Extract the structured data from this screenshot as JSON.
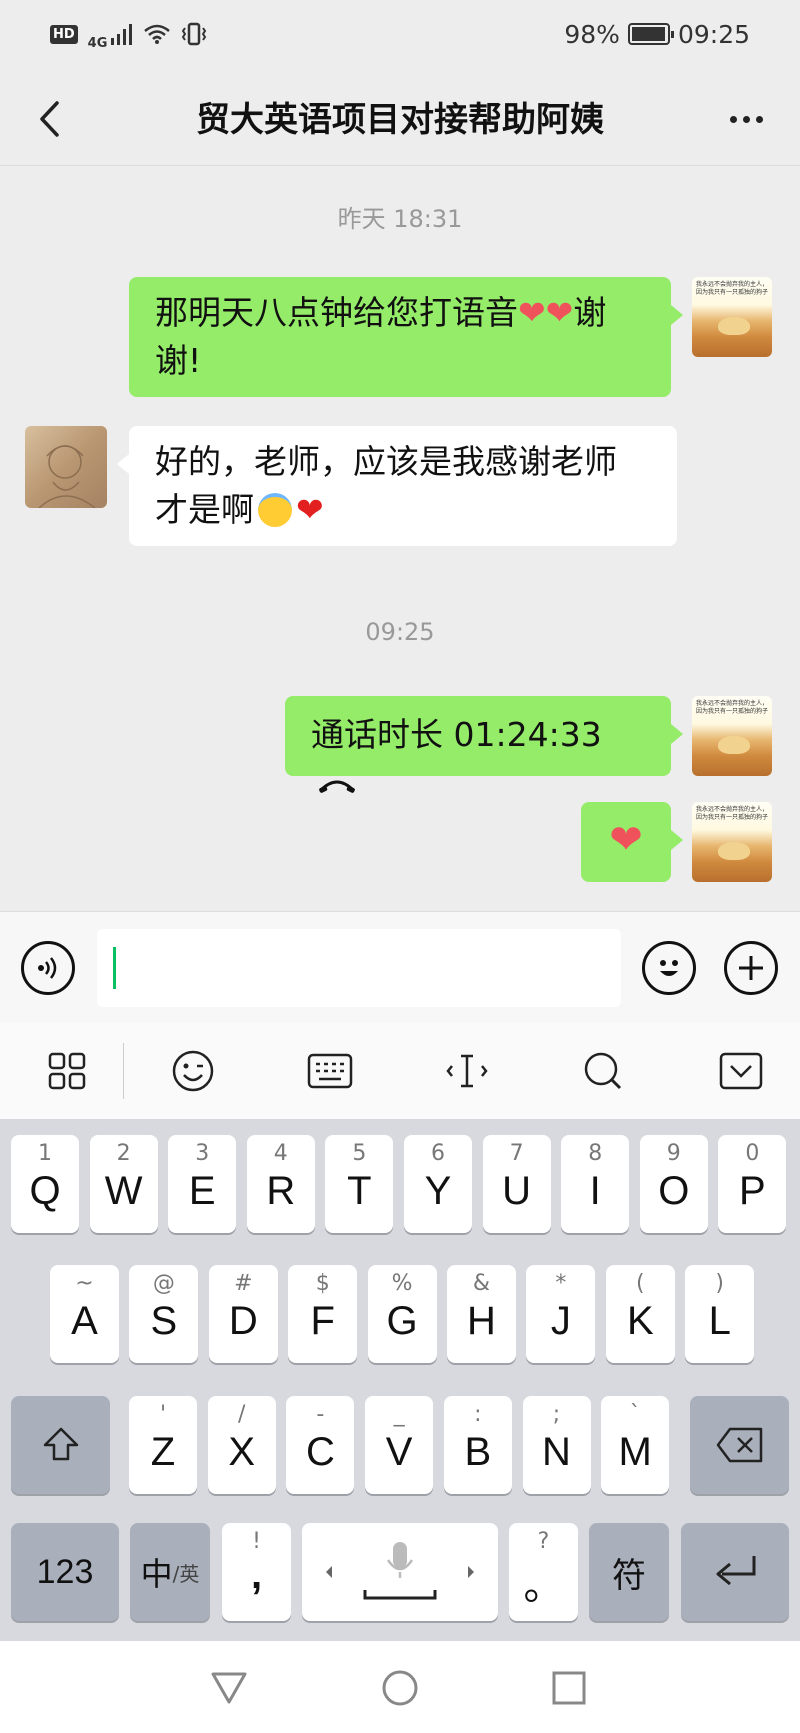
{
  "status_bar": {
    "hd": "HD",
    "network": "4G",
    "battery": "98%",
    "time": "09:25"
  },
  "header": {
    "title": "贸大英语项目对接帮助阿姨"
  },
  "messages": {
    "ts1": "昨天 18:31",
    "msg1_line1": "那明天八点钟给您打语音",
    "msg1_line1_end": "谢",
    "msg1_line2": "谢!",
    "msg2_line1": "好的，老师，应该是我感谢老师",
    "msg2_line2": "才是啊",
    "ts2": "09:25",
    "call_text": "通话时长 01:24:33",
    "heart": "❤",
    "sticker_text": "我永远不会抛弃我的主人，因为我只有一只孤独的狗子"
  },
  "input": {
    "value": ""
  },
  "keyboard": {
    "row1": [
      {
        "hint": "1",
        "label": "Q"
      },
      {
        "hint": "2",
        "label": "W"
      },
      {
        "hint": "3",
        "label": "E"
      },
      {
        "hint": "4",
        "label": "R"
      },
      {
        "hint": "5",
        "label": "T"
      },
      {
        "hint": "6",
        "label": "Y"
      },
      {
        "hint": "7",
        "label": "U"
      },
      {
        "hint": "8",
        "label": "I"
      },
      {
        "hint": "9",
        "label": "O"
      },
      {
        "hint": "0",
        "label": "P"
      }
    ],
    "row2": [
      {
        "hint": "~",
        "label": "A"
      },
      {
        "hint": "@",
        "label": "S"
      },
      {
        "hint": "#",
        "label": "D"
      },
      {
        "hint": "$",
        "label": "F"
      },
      {
        "hint": "%",
        "label": "G"
      },
      {
        "hint": "&",
        "label": "H"
      },
      {
        "hint": "*",
        "label": "J"
      },
      {
        "hint": "(",
        "label": "K"
      },
      {
        "hint": ")",
        "label": "L"
      }
    ],
    "row3": [
      {
        "hint": "'",
        "label": "Z"
      },
      {
        "hint": "/",
        "label": "X"
      },
      {
        "hint": "-",
        "label": "C"
      },
      {
        "hint": "_",
        "label": "V"
      },
      {
        "hint": ":",
        "label": "B"
      },
      {
        "hint": ";",
        "label": "N"
      },
      {
        "hint": "`",
        "label": "M"
      }
    ],
    "key_123": "123",
    "key_zh": "中",
    "key_en": "/英",
    "key_comma_hint": "!",
    "key_comma": ",",
    "key_period_hint": "?",
    "key_period": "。",
    "key_symbol": "符"
  },
  "colors": {
    "my_bubble": "#95ec69",
    "other_bubble": "#ffffff",
    "chat_bg": "#ededed",
    "caret": "#07c160",
    "heart": "#f0525c"
  }
}
